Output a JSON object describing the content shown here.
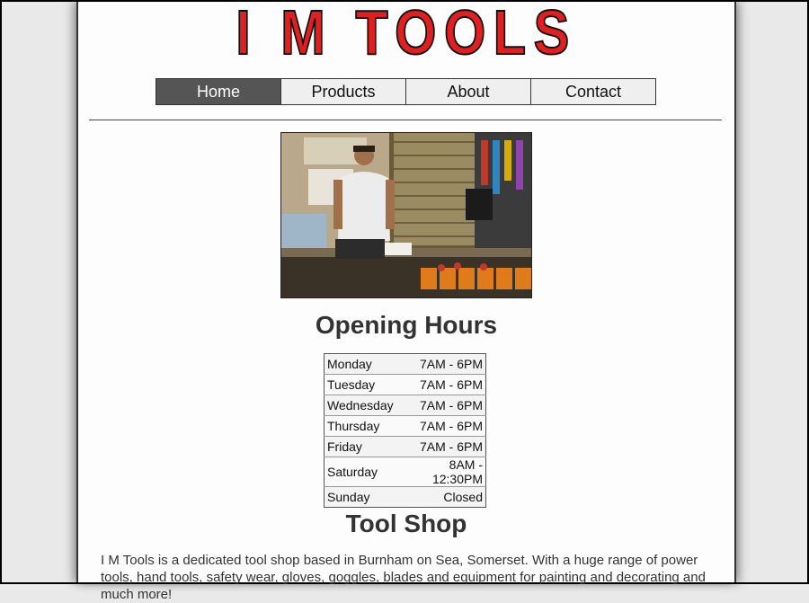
{
  "site": {
    "logo_text": "I M TOOLS"
  },
  "nav": {
    "items": [
      {
        "label": "Home",
        "active": true
      },
      {
        "label": "Products"
      },
      {
        "label": "About"
      },
      {
        "label": "Contact"
      }
    ]
  },
  "hours": {
    "title": "Opening Hours",
    "rows": [
      {
        "day": "Monday",
        "time": "7AM - 6PM"
      },
      {
        "day": "Tuesday",
        "time": "7AM - 6PM"
      },
      {
        "day": "Wednesday",
        "time": "7AM - 6PM"
      },
      {
        "day": "Thursday",
        "time": "7AM - 6PM"
      },
      {
        "day": "Friday",
        "time": "7AM - 6PM"
      },
      {
        "day": "Saturday",
        "time": "8AM - 12:30PM"
      },
      {
        "day": "Sunday",
        "time": "Closed"
      }
    ]
  },
  "shop": {
    "title": "Tool Shop",
    "description": "I M Tools is a dedicated tool shop based in Burnham on Sea, Somerset. With a huge range of power tools, hand tools, safety wear, gloves, goggles, blades and equipment for painting and decorating and much more!"
  },
  "colors": {
    "logo_red": "#e02020",
    "nav_active_bg": "#555555"
  }
}
